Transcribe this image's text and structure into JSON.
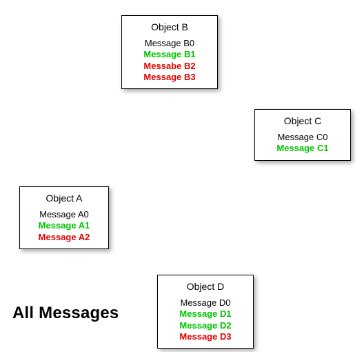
{
  "headline": "All Messages",
  "colors": {
    "green": "#00c400",
    "red": "#e30000",
    "black": "#000000"
  },
  "objects": {
    "a": {
      "title": "Object A",
      "messages": [
        {
          "text": "Message A0",
          "color": "black"
        },
        {
          "text": "Message A1",
          "color": "green"
        },
        {
          "text": "Message A2",
          "color": "red"
        }
      ]
    },
    "b": {
      "title": "Object B",
      "messages": [
        {
          "text": "Message B0",
          "color": "black"
        },
        {
          "text": "Message B1",
          "color": "green"
        },
        {
          "text": "Messabe B2",
          "color": "red"
        },
        {
          "text": "Message B3",
          "color": "red"
        }
      ]
    },
    "c": {
      "title": "Object C",
      "messages": [
        {
          "text": "Message C0",
          "color": "black"
        },
        {
          "text": "Message C1",
          "color": "green"
        }
      ]
    },
    "d": {
      "title": "Object D",
      "messages": [
        {
          "text": "Message D0",
          "color": "black"
        },
        {
          "text": "Message D1",
          "color": "green"
        },
        {
          "text": "Message D2",
          "color": "green"
        },
        {
          "text": "Message D3",
          "color": "red"
        }
      ]
    }
  }
}
